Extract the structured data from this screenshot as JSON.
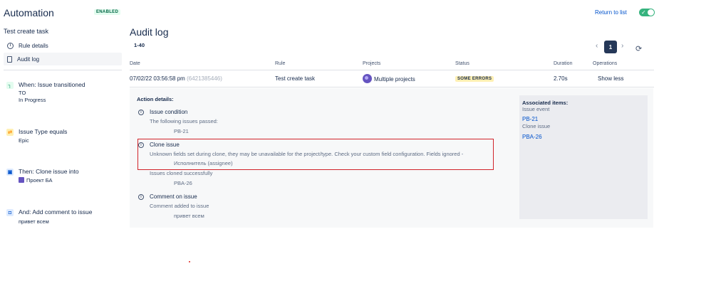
{
  "header": {
    "app_title": "Automation",
    "status_badge": "ENABLED",
    "return_link": "Return to list",
    "toggle_check": "✓"
  },
  "sidebar": {
    "rule_name": "Test create task",
    "nav": [
      {
        "label": "Rule details",
        "icon": "info-icon"
      },
      {
        "label": "Audit log",
        "icon": "document-icon"
      }
    ],
    "steps": [
      {
        "title": "When: Issue transitioned",
        "lines": [
          "TO",
          "In Progress"
        ],
        "icon": "transition-icon"
      },
      {
        "title": "Issue Type equals",
        "lines": [
          "Epic"
        ],
        "icon": "shuffle-icon"
      },
      {
        "title": "Then: Clone issue into",
        "lines": [
          "Проект БА"
        ],
        "icon": "clone-icon"
      },
      {
        "title": "And: Add comment to issue",
        "lines": [
          "привет всем"
        ],
        "icon": "comment-icon"
      }
    ]
  },
  "main": {
    "title": "Audit log",
    "range": "1-40",
    "pager": {
      "prev": "‹",
      "current": "1",
      "next": "›",
      "refresh": "⟳"
    },
    "columns": [
      "Date",
      "Rule",
      "Projects",
      "Status",
      "Duration",
      "Operations"
    ],
    "row": {
      "date": "07/02/22 03:56:58 pm",
      "id": "(6421385446)",
      "rule": "Test create task",
      "projects": "Multiple projects",
      "status": "SOME ERRORS",
      "duration": "2.70s",
      "operation": "Show less"
    },
    "details": {
      "heading": "Action details:",
      "actions": [
        {
          "title": "Issue condition",
          "lines": [
            "The following issues passed:"
          ],
          "indented": [
            "PB-21"
          ]
        },
        {
          "title": "Clone issue",
          "lines": [
            "Unknown fields set during clone, they may be unavailable for the project/type. Check your custom field configuration. Fields ignored -"
          ],
          "indented": [
            "Исполнитель (assignee)"
          ],
          "lines2": [
            "Issues cloned successfully"
          ],
          "indented2": [
            "PBA-26"
          ]
        },
        {
          "title": "Comment on issue",
          "lines": [
            "Comment added to issue"
          ],
          "indented": [
            "привет всем"
          ]
        }
      ]
    },
    "associated": {
      "title": "Associated items:",
      "groups": [
        {
          "label": "Issue event",
          "link": "PB-21"
        },
        {
          "label": "Clone issue",
          "link": "PBA-26"
        }
      ]
    }
  },
  "colors": {
    "accent": "#0052cc",
    "toggle_on": "#36b37e",
    "highlight": "#d1232a",
    "warning": "#fff0b3"
  }
}
